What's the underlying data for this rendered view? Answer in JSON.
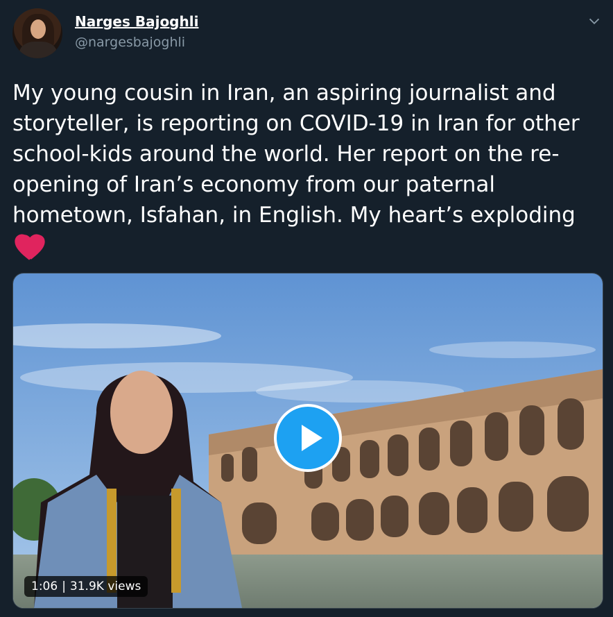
{
  "user": {
    "name": "Narges Bajoghli",
    "handle": "@nargesbajoghli"
  },
  "tweet": {
    "text": "My young cousin in Iran, an aspiring journalist and\nstoryteller, is reporting on COVID-19 in Iran for other\nschool-kids around the world. Her report on the re-\nopening of Iran’s economy from our paternal\nhometown, Isfahan, in English. My heart’s exploding"
  },
  "video": {
    "duration": "1:06",
    "separator": "|",
    "views": "31.9K views"
  },
  "icons": {
    "menu": "chevron-down-icon",
    "heart": "red-heart-emoji",
    "play": "play-icon"
  },
  "colors": {
    "background": "#15202b",
    "secondary_text": "#8899a6",
    "accent": "#1da1f2",
    "heart": "#e0245e"
  }
}
